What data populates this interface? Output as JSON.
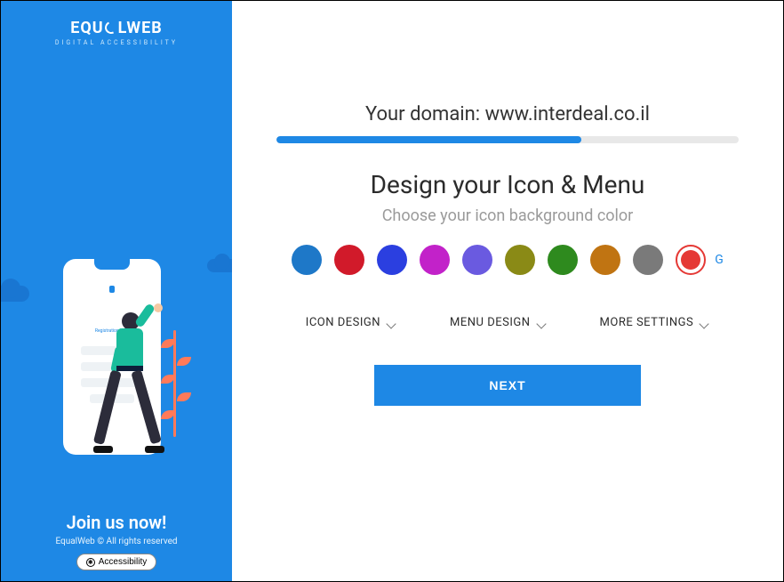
{
  "brand": {
    "name_pre": "EQU",
    "name_post": "LWEB",
    "tagline": "DIGITAL ACCESSIBILITY"
  },
  "sidebar": {
    "phone_title": "Registration Now",
    "join": "Join us now!",
    "copyright": "EqualWeb © All rights reserved",
    "accessibility_label": "Accessibility"
  },
  "main": {
    "domain_prefix": "Your domain: ",
    "domain_value": "www.interdeal.co.il",
    "progress_percent": 66,
    "title": "Design your Icon & Menu",
    "subtitle": "Choose your icon background color",
    "swatches": [
      {
        "name": "blue",
        "hex": "#1e78c8"
      },
      {
        "name": "red",
        "hex": "#d11a2a"
      },
      {
        "name": "indigo",
        "hex": "#2b3fe0"
      },
      {
        "name": "magenta",
        "hex": "#c222c9"
      },
      {
        "name": "violet",
        "hex": "#6a5ae0"
      },
      {
        "name": "olive",
        "hex": "#8a8a16"
      },
      {
        "name": "green",
        "hex": "#2e8a1e"
      },
      {
        "name": "orange",
        "hex": "#c07412"
      },
      {
        "name": "grey",
        "hex": "#7a7a7a"
      }
    ],
    "custom_swatch_hex": "#e53935",
    "trailing_letter": "G",
    "dropdowns": {
      "icon_design": "ICON DESIGN",
      "menu_design": "MENU DESIGN",
      "more_settings": "MORE SETTINGS"
    },
    "next_label": "NEXT"
  }
}
